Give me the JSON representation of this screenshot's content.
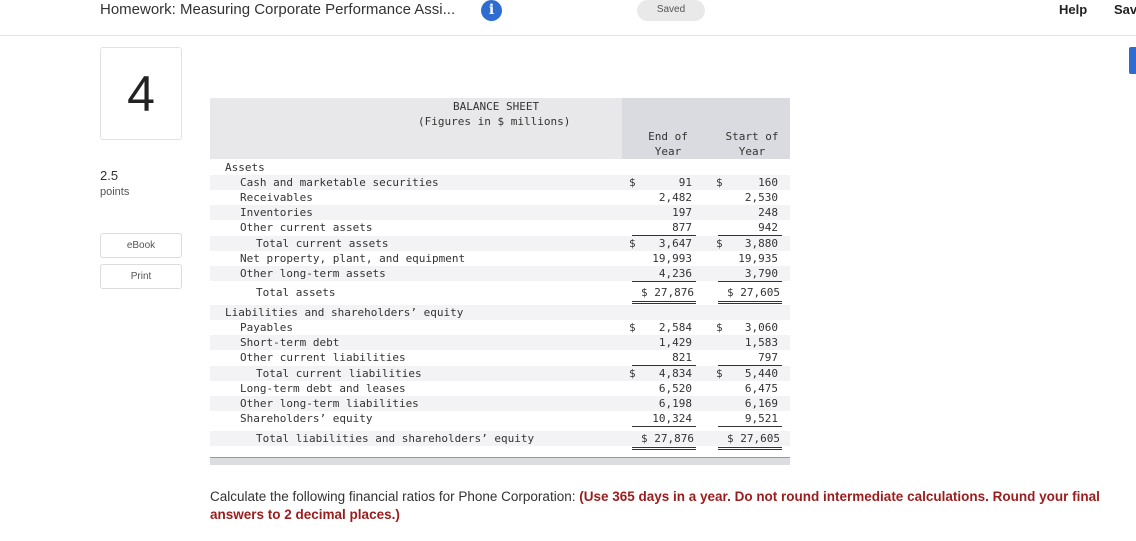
{
  "header": {
    "title": "Homework: Measuring Corporate Performance Assi...",
    "saved_label": "Saved",
    "help_label": "Help",
    "save_label": "Sav"
  },
  "question": {
    "number": "4",
    "points_value": "2.5",
    "points_label": "points",
    "ebook_label": "eBook",
    "print_label": "Print"
  },
  "balance_sheet": {
    "title": "BALANCE SHEET",
    "subtitle": "(Figures in $ millions)",
    "col_end_line1": "End of",
    "col_end_line2": "Year",
    "col_start_line1": "Start of",
    "col_start_line2": "Year",
    "assets_heading": "Assets",
    "liab_heading": "Liabilities and shareholders’ equity",
    "rows": [
      {
        "label": "Cash and marketable securities",
        "end": "91",
        "start": "160"
      },
      {
        "label": "Receivables",
        "end": "2,482",
        "start": "2,530"
      },
      {
        "label": "Inventories",
        "end": "197",
        "start": "248"
      },
      {
        "label": "Other current assets",
        "end": "877",
        "start": "942"
      },
      {
        "label": "Total current assets",
        "end": "3,647",
        "start": "3,880"
      },
      {
        "label": "Net property, plant, and equipment",
        "end": "19,993",
        "start": "19,935"
      },
      {
        "label": "Other long-term assets",
        "end": "4,236",
        "start": "3,790"
      },
      {
        "label": "Total assets",
        "end": "$ 27,876",
        "start": "$ 27,605"
      },
      {
        "label": "Payables",
        "end": "2,584",
        "start": "3,060"
      },
      {
        "label": "Short-term debt",
        "end": "1,429",
        "start": "1,583"
      },
      {
        "label": "Other current liabilities",
        "end": "821",
        "start": "797"
      },
      {
        "label": "Total current liabilities",
        "end": "4,834",
        "start": "5,440"
      },
      {
        "label": "Long-term debt and leases",
        "end": "6,520",
        "start": "6,475"
      },
      {
        "label": "Other long-term liabilities",
        "end": "6,198",
        "start": "6,169"
      },
      {
        "label": "Shareholders’ equity",
        "end": "10,324",
        "start": "9,521"
      },
      {
        "label": "Total liabilities and shareholders’ equity",
        "end": "$ 27,876",
        "start": "$ 27,605"
      }
    ],
    "dollar_sign": "$"
  },
  "instructions": {
    "normal": "Calculate the following financial ratios for Phone Corporation: ",
    "emphasis": "(Use 365 days in a year. Do not round intermediate calculations. Round your final answers to 2 decimal places.)"
  },
  "colors": {
    "accent": "#2f6cd1",
    "emphasis_red": "#9b1c1c"
  },
  "icons": {
    "info": "info-icon"
  }
}
